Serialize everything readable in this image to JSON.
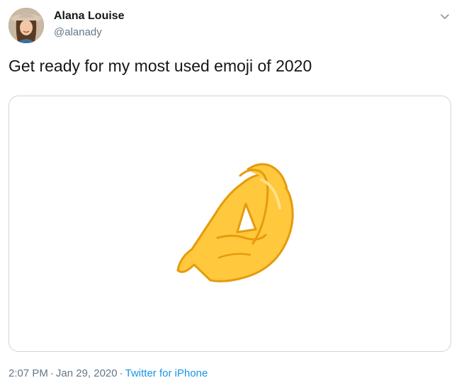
{
  "user": {
    "display_name": "Alana Louise",
    "handle": "@alanady",
    "avatar_icon": "profile-photo"
  },
  "tweet": {
    "text": "Get ready for my most used emoji of 2020",
    "media_icon": "pinched-fingers-emoji"
  },
  "meta": {
    "time": "2:07 PM",
    "date": "Jan 29, 2020",
    "separator": "·",
    "source": "Twitter for iPhone"
  },
  "colors": {
    "link": "#1b95e0",
    "secondary_text": "#657786",
    "border": "#ccd6dd",
    "emoji_fill": "#FFC83D",
    "emoji_outline": "#E59B0D"
  },
  "menu": {
    "icon": "chevron-down-icon"
  }
}
